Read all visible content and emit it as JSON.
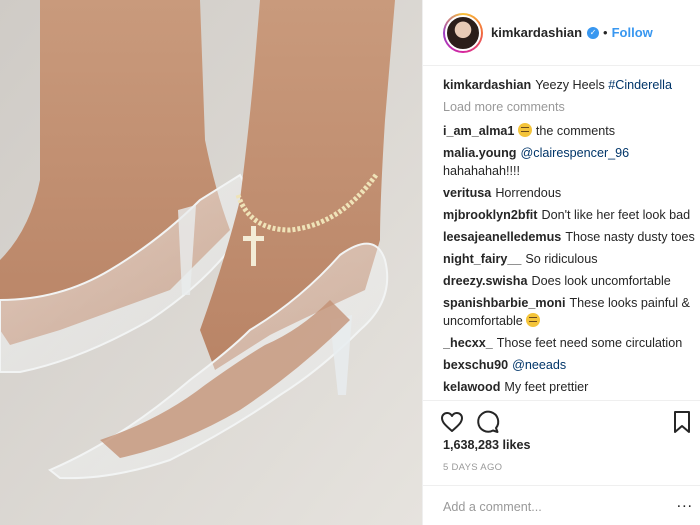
{
  "post": {
    "image_alt": "Clear plastic pointed heels on feet with ankle chain and cross charm"
  },
  "header": {
    "username": "kimkardashian",
    "verified_mark": "✓",
    "separator": "•",
    "follow_label": "Follow"
  },
  "caption": {
    "author": "kimkardashian",
    "text": "Yeezy Heels",
    "hashtag": "#Cinderella"
  },
  "load_more_label": "Load more comments",
  "comments": [
    {
      "author": "i_am_alma1",
      "pre": "",
      "emoji": "grinning-face-emoji",
      "text": " the comments"
    },
    {
      "author": "malia.young",
      "mention": "@clairespencer_96",
      "text": " hahahahah!!!!"
    },
    {
      "author": "veritusa",
      "text": "Horrendous"
    },
    {
      "author": "mjbrooklyn2bfit",
      "text": "Don't like her feet look bad"
    },
    {
      "author": "leesajeanelledemus",
      "text": "Those nasty dusty toes"
    },
    {
      "author": "night_fairy__",
      "text": "So ridiculous"
    },
    {
      "author": "dreezy.swisha",
      "text": "Does look uncomfortable"
    },
    {
      "author": "spanishbarbie_moni",
      "text": "These looks painful & uncomfortable ",
      "emoji": "grimace-emoji"
    },
    {
      "author": "_hecxx_",
      "text": "Those feet need some circulation"
    },
    {
      "author": "bexschu90",
      "mention": "@neeads",
      "text": ""
    },
    {
      "author": "kelawood",
      "text": "My feet prettier"
    }
  ],
  "actions": {
    "like_icon": "heart-icon",
    "comment_icon": "comment-bubble-icon",
    "save_icon": "bookmark-icon"
  },
  "likes_text": "1,638,283 likes",
  "timestamp": "5 DAYS AGO",
  "add_comment": {
    "placeholder": "Add a comment...",
    "more_label": "..."
  },
  "colors": {
    "link": "#3897f0",
    "mention": "#003569",
    "muted": "#999999",
    "text": "#262626"
  }
}
